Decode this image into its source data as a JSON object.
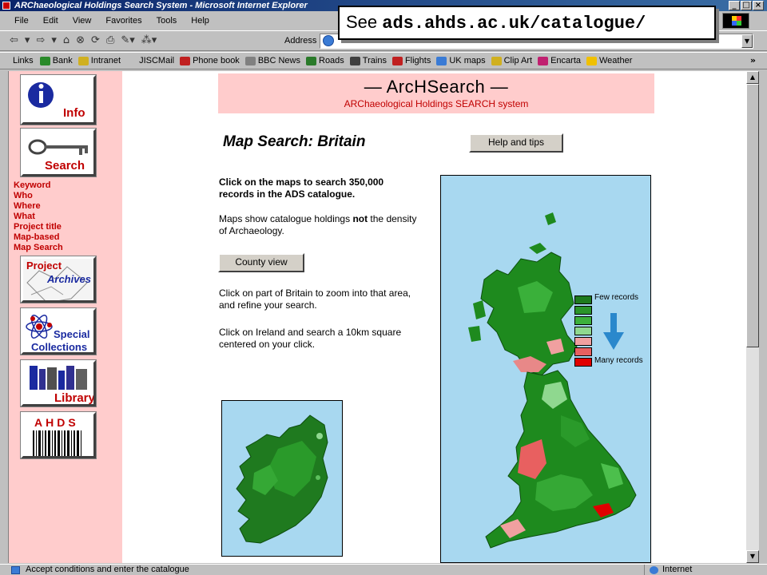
{
  "window": {
    "title": "ARChaeological Holdings Search System - Microsoft Internet Explorer",
    "buttons": [
      "_",
      "□",
      "×"
    ]
  },
  "menu": [
    "File",
    "Edit",
    "View",
    "Favorites",
    "Tools",
    "Help"
  ],
  "toolbar": {
    "icons": [
      "⇦",
      "▾",
      "⇨",
      "▾",
      "⌂",
      "⊗",
      "⟳",
      "⎙",
      "✎▾",
      "⁂▾"
    ],
    "address_label": "Address",
    "address_value": ""
  },
  "links": {
    "label": "Links",
    "more": "»",
    "items": [
      {
        "label": "Bank",
        "icon": "bank-icon",
        "color": "#2a8a2a"
      },
      {
        "label": "Intranet",
        "icon": "intranet-icon",
        "color": "#d0b020"
      },
      {
        "label": "JISCMail",
        "icon": "mail-icon",
        "color": "#c0c0c0"
      },
      {
        "label": "Phone book",
        "icon": "phone-icon",
        "color": "#c02020"
      },
      {
        "label": "BBC News",
        "icon": "news-icon",
        "color": "#808080"
      },
      {
        "label": "Roads",
        "icon": "roads-icon",
        "color": "#2a7a2a"
      },
      {
        "label": "Trains",
        "icon": "trains-icon",
        "color": "#404040"
      },
      {
        "label": "Flights",
        "icon": "flights-icon",
        "color": "#c02020"
      },
      {
        "label": "UK maps",
        "icon": "map-icon",
        "color": "#3a7bd5"
      },
      {
        "label": "Clip Art",
        "icon": "clipart-icon",
        "color": "#d0b020"
      },
      {
        "label": "Encarta",
        "icon": "encarta-icon",
        "color": "#c02070"
      },
      {
        "label": "Weather",
        "icon": "weather-icon",
        "color": "#f0c000"
      }
    ]
  },
  "nav": {
    "info_label": "Info",
    "search_label": "Search",
    "links": [
      "Keyword",
      "Who",
      "Where",
      "What",
      "Project title",
      "Map-based",
      "Map Search"
    ],
    "project_label": "Project",
    "archives_label": "Archives",
    "special_label": "Special",
    "collections_label": "Collections",
    "library_label": "Library",
    "ahds_label": "AHDS"
  },
  "banner": {
    "title": "— ArcHSearch —",
    "subtitle": "ARChaeological Holdings SEARCH system"
  },
  "page": {
    "title": "Map Search: Britain",
    "help_button": "Help and tips",
    "intro_bold": "Click on the maps to search 350,000 records in the ADS catalogue.",
    "note_pre": "Maps show catalogue holdings ",
    "note_bold": "not",
    "note_post": " the density of Archaeology.",
    "county_button": "County view",
    "zoom_text": "Click on part of Britain to zoom into that area, and refine your search.",
    "ireland_text": "Click on Ireland and search a 10km square centered on your click."
  },
  "legend": {
    "few": "Few records",
    "many": "Many records",
    "colors": [
      "#1e7a1e",
      "#2a942a",
      "#3cb03c",
      "#8fd88f",
      "#f0a0a0",
      "#e86060",
      "#e00000"
    ]
  },
  "status": {
    "text": "Accept conditions and enter the catalogue",
    "zone": "Internet"
  },
  "callout": {
    "prefix": "See",
    "url": "ads.ahds.ac.uk/catalogue/"
  }
}
